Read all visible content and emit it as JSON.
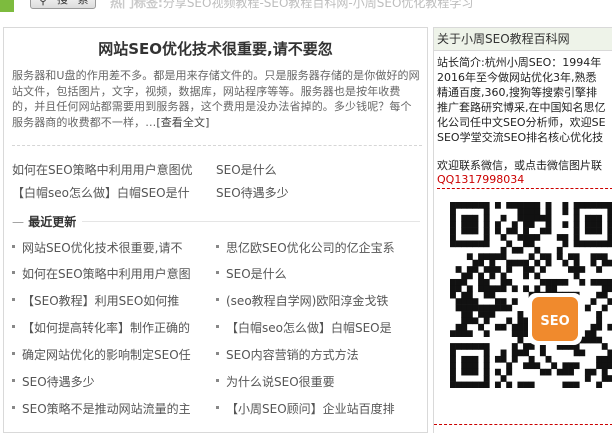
{
  "topbar": {
    "search_label": "搜 索",
    "hot_label": "热门标签:",
    "hot_text": "分享SEO视频教程-SEO教程百科网-小周SEO优化教程学习"
  },
  "article": {
    "title": "网站SEO优化技术很重要,请不要忽",
    "excerpt": "服务器和U盘的作用差不多。都是用来存储文件的。只是服务器存储的是你做好的网站文件，包括图片，文字，视频，数据库，网站程序等等。服务器也是按年收费的，并且任何网站都需要用到服务器，这个费用是没办法省掉的。多少钱呢？每个服务器商的收费都不一样，…",
    "more_link": "[查看全文]"
  },
  "related": [
    "如何在SEO策略中利用用户意图优",
    "SEO是什么",
    "【白帽seo怎么做】白帽SEO是什",
    "SEO待遇多少"
  ],
  "recent": {
    "dash": "—",
    "title": "最近更新",
    "items": [
      "网站SEO优化技术很重要,请不",
      "思亿欧SEO优化公司的亿企宝系",
      "如何在SEO策略中利用用户意图",
      "SEO是什么",
      "【SEO教程】利用SEO如何推",
      "(seo教程自学网)欧阳淳金戈铁",
      "【如何提高转化率】制作正确的",
      "【白帽seo怎么做】白帽SEO是",
      "确定网站优化的影响制定SEO任",
      "SEO内容营销的方式方法",
      "SEO待遇多少",
      "为什么说SEO很重要",
      "SEO策略不是推动网站流量的主",
      "【小周SEO顾问】企业站百度排"
    ]
  },
  "sidebar": {
    "title": "关于小周SEO教程百科网",
    "intro_lines": [
      "站长简介:杭州小周SEO：1994年",
      "2016年至今做网站优化3年,熟悉",
      "精通百度,360,搜狗等搜索引擎排",
      "推广套路研究博采,在中国知名思亿",
      "化公司任中文SEO分析师，欢迎SE",
      "SEO学堂交流SEO排名核心优化技"
    ],
    "contact": "欢迎联系微信，或点击微信图片联",
    "qq": "QQ1317998034",
    "qr_center_text": "SEO"
  },
  "colors": {
    "accent_green": "#eef3e9",
    "qq_red": "#cc0000",
    "logo_orange": "#f08a2d"
  }
}
